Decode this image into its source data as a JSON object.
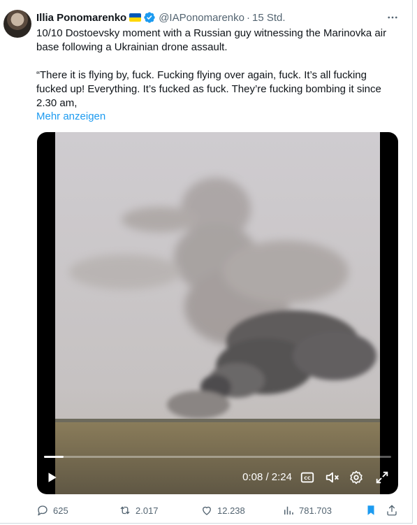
{
  "tweet": {
    "author_name": "Illia Ponomarenko",
    "handle": "@IAPonomarenko",
    "time": "15 Std.",
    "separator": "·",
    "text": "10/10 Dostoevsky moment with a Russian guy witnessing the Marinovka air base following a Ukrainian drone assault.\n\n“There it is flying by, fuck. Fucking flying over again, fuck. It’s all fucking fucked up! Everything. It’s fucked as fuck. They’re fucking bombing it since 2.30 am,",
    "show_more": "Mehr anzeigen",
    "more_menu_icon": "more-dots-icon",
    "verified_icon": "verified-badge-icon",
    "flag_icon": "ukraine-flag-icon"
  },
  "video": {
    "time_display": "0:08 / 2:24",
    "progress": 0.056,
    "icons": [
      "play-icon",
      "captions-icon",
      "mute-icon",
      "settings-icon",
      "fullscreen-icon"
    ]
  },
  "actions": {
    "replies": "625",
    "reposts": "2.017",
    "likes": "12.238",
    "views": "781.703",
    "bookmark_icon": "bookmark-icon",
    "share_icon": "share-icon"
  },
  "colors": {
    "text": "#0f1419",
    "secondary": "#536471",
    "link": "#1d9bf0",
    "verified": "#1d9bf0"
  }
}
